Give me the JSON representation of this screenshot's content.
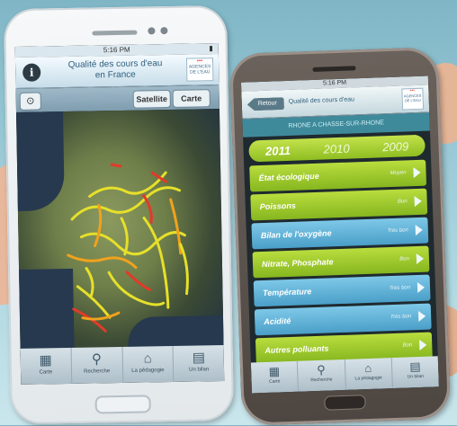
{
  "left_phone": {
    "status": {
      "time": "5:16 PM"
    },
    "header": {
      "info_icon": "info-icon",
      "title_line1": "Qualité des cours d'eau",
      "title_line2": "en France",
      "logo_text": "AGENCES DE L'EAU"
    },
    "map_toolbar": {
      "locate_icon": "locate-icon",
      "satellite_label": "Satellite",
      "carte_label": "Carte"
    },
    "tabs": [
      {
        "label": "Carte",
        "icon": "map-icon"
      },
      {
        "label": "Recherche",
        "icon": "search-icon"
      },
      {
        "label": "La pédagogie",
        "icon": "mortarboard-icon"
      },
      {
        "label": "Un bilan",
        "icon": "info-card-icon"
      }
    ]
  },
  "right_phone": {
    "status": {
      "time": "5:16 PM"
    },
    "header": {
      "back_label": "Retour",
      "title": "Qualité des cours d'eau",
      "logo_text": "AGENCES DE L'EAU"
    },
    "subtitle": "RHONE A CHASSE-SUR-RHONE",
    "years": [
      "2011",
      "2010",
      "2009"
    ],
    "selected_year": "2011",
    "rows": [
      {
        "label": "État écologique",
        "value": "Moyen",
        "color": "green"
      },
      {
        "label": "Poissons",
        "value": "Bon",
        "color": "green"
      },
      {
        "label": "Bilan de l'oxygène",
        "value": "Très bon",
        "color": "blue"
      },
      {
        "label": "Nitrate, Phosphate",
        "value": "Bon",
        "color": "green"
      },
      {
        "label": "Température",
        "value": "Très bon",
        "color": "blue"
      },
      {
        "label": "Acidité",
        "value": "Très bon",
        "color": "blue"
      },
      {
        "label": "Autres polluants",
        "value": "Bon",
        "color": "green"
      }
    ],
    "tabs": [
      {
        "label": "Carte",
        "icon": "map-icon"
      },
      {
        "label": "Recherche",
        "icon": "search-icon"
      },
      {
        "label": "La pédagogie",
        "icon": "mortarboard-icon"
      },
      {
        "label": "Un bilan",
        "icon": "info-card-icon"
      }
    ]
  },
  "colors": {
    "river_good": "#e6e02a",
    "river_medium": "#f0a21d",
    "river_bad": "#e23a2a",
    "row_green": "#a6cf2f",
    "row_blue": "#5fb4dc"
  }
}
